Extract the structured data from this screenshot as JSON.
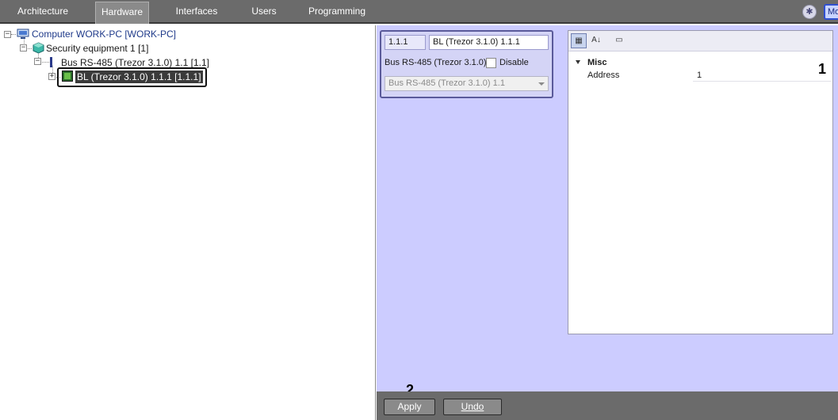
{
  "tabs": [
    {
      "label": "Architecture",
      "active": false
    },
    {
      "label": "Hardware",
      "active": true
    },
    {
      "label": "Interfaces",
      "active": false
    },
    {
      "label": "Users",
      "active": false
    },
    {
      "label": "Programming",
      "active": false
    }
  ],
  "toolbar_right": {
    "settings_icon": "gear-icon",
    "monitor_label": "Mo"
  },
  "tree": {
    "computer": "Computer WORK-PC [WORK-PC]",
    "security": "Security equipment 1 [1]",
    "bus": "Bus RS-485 (Trezor 3.1.0) 1.1 [1.1]",
    "device": "BL (Trezor 3.1.0) 1.1.1 [1.1.1]"
  },
  "card": {
    "address": "1.1.1",
    "name": "BL (Trezor 3.1.0) 1.1.1",
    "parent_label": "Bus RS-485 (Trezor 3.1.0)",
    "disable_label": "Disable",
    "disable_checked": false,
    "select_value": "Bus RS-485 (Trezor 3.1.0) 1.1"
  },
  "propgrid": {
    "category": "Misc",
    "property_name": "Address",
    "property_value": "1"
  },
  "callouts": {
    "one": "1",
    "two": "2"
  },
  "buttons": {
    "apply": "Apply",
    "undo": "Undo"
  }
}
